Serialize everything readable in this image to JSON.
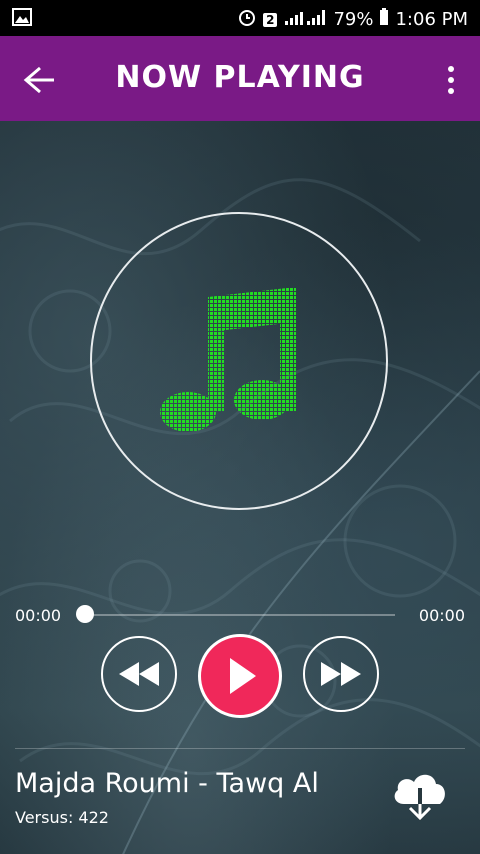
{
  "status_bar": {
    "sim_badge": "2",
    "battery": "79%",
    "time": "1:06 PM"
  },
  "app_bar": {
    "title": "NOW PLAYING",
    "color": "#7a1a86"
  },
  "player": {
    "current_time": "00:00",
    "total_time": "00:00",
    "progress": 0,
    "play_color": "#f0285a",
    "note_color": "#22dd22"
  },
  "track": {
    "title": "Majda Roumi - Tawq Al",
    "versus": "Versus: 422"
  },
  "icons": {
    "back": "arrow-left-icon",
    "menu": "more-vert-icon",
    "rewind": "rewind-icon",
    "play": "play-icon",
    "forward": "fast-forward-icon",
    "download": "cloud-download-icon",
    "art": "music-note-icon"
  }
}
